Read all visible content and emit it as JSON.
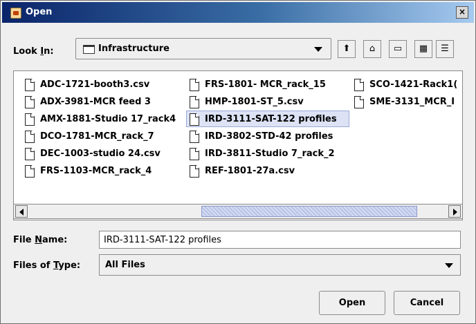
{
  "window": {
    "title": "Open",
    "close_label": "×"
  },
  "look_in": {
    "label_prefix": "Look ",
    "label_mnemonic": "I",
    "label_suffix": "n:",
    "value": "Infrastructure"
  },
  "toolbar": {
    "up_icon": "up-folder-icon",
    "home_icon": "home-icon",
    "new_folder_icon": "new-folder-icon",
    "list_view_icon": "list-view-icon",
    "details_view_icon": "details-view-icon",
    "up_glyph": "⬆",
    "home_glyph": "⌂",
    "new_folder_glyph": "▭",
    "list_glyph": "▦",
    "details_glyph": "☰"
  },
  "files": [
    "ADC-1721-booth3.csv",
    "ADX-3981-MCR feed 3",
    "AMX-1881-Studio 17_rack4",
    "DCO-1781-MCR_rack_7",
    "DEC-1003-studio 24.csv",
    "FRS-1103-MCR_rack_4",
    "FRS-1801- MCR_rack_15",
    "HMP-1801-ST_5.csv",
    "IRD-3111-SAT-122 profiles",
    "IRD-3802-STD-42 profiles",
    "IRD-3811-Studio 7_rack_2",
    "REF-1801-27a.csv",
    "SCO-1421-Rack1(",
    "SME-3131_MCR_I"
  ],
  "selected_file": "IRD-3111-SAT-122 profiles",
  "file_name": {
    "label_prefix": "File ",
    "label_mnemonic": "N",
    "label_suffix": "ame:",
    "value": "IRD-3111-SAT-122 profiles"
  },
  "files_of_type": {
    "label_prefix": "Files of ",
    "label_mnemonic": "T",
    "label_suffix": "ype:",
    "value": "All Files"
  },
  "buttons": {
    "open": "Open",
    "cancel": "Cancel"
  }
}
